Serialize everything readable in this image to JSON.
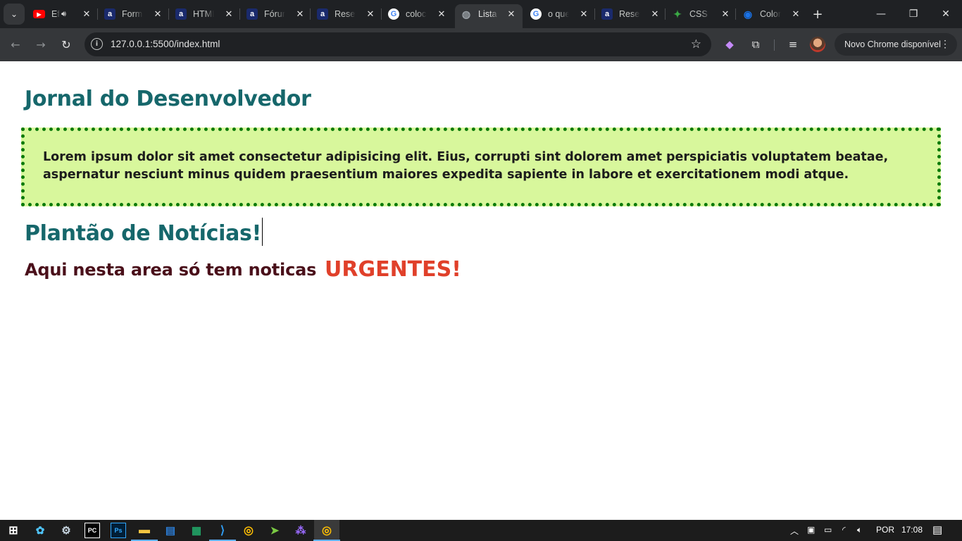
{
  "browser": {
    "tabs": [
      {
        "title": "Ef",
        "favicon": "youtube-icon",
        "color": "#ff0000",
        "glyph": "▶",
        "audio": true
      },
      {
        "title": "Formu",
        "favicon": "alura-icon",
        "color": "#1a2a6c",
        "glyph": "a"
      },
      {
        "title": "HTML",
        "favicon": "alura-icon",
        "color": "#1a2a6c",
        "glyph": "a"
      },
      {
        "title": "Fórum",
        "favicon": "alura-icon",
        "color": "#1a2a6c",
        "glyph": "a"
      },
      {
        "title": "Reset",
        "favicon": "alura-icon",
        "color": "#1a2a6c",
        "glyph": "a"
      },
      {
        "title": "coloca",
        "favicon": "google-icon",
        "color": "#ffffff",
        "glyph": "G"
      },
      {
        "title": "Lista d",
        "favicon": "globe-icon",
        "color": "#9aa0a6",
        "glyph": "◍",
        "active": true
      },
      {
        "title": "o que",
        "favicon": "google-icon",
        "color": "#ffffff",
        "glyph": "G"
      },
      {
        "title": "Reset",
        "favicon": "alura-icon",
        "color": "#1a2a6c",
        "glyph": "a"
      },
      {
        "title": "CSS R",
        "favicon": "css-reference-icon",
        "color": "#3aa845",
        "glyph": "✦"
      },
      {
        "title": "Color",
        "favicon": "chrome-color-icon",
        "color": "#1a73e8",
        "glyph": "◉"
      }
    ],
    "url": "127.0.0.1:5500/index.html",
    "update_label": "Novo Chrome disponível"
  },
  "page": {
    "title": "Jornal do Desenvolvedor",
    "box_text": "Lorem ipsum dolor sit amet consectetur adipisicing elit. Eius, corrupti sint dolorem amet perspiciatis voluptatem beatae, aspernatur nesciunt minus quidem praesentium maiores expedita sapiente in labore et exercitationem modi atque.",
    "subtitle": "Plantão de Notícias!",
    "notice": "Aqui nesta area só tem noticas",
    "urgent": "URGENTES!",
    "colors": {
      "heading": "#16676b",
      "box_bg": "#d8f79c",
      "box_border": "#0a7a0a",
      "notice": "#4a0f1a",
      "urgent": "#e0402a"
    }
  },
  "taskbar": {
    "language": "POR",
    "time": "17:08"
  }
}
